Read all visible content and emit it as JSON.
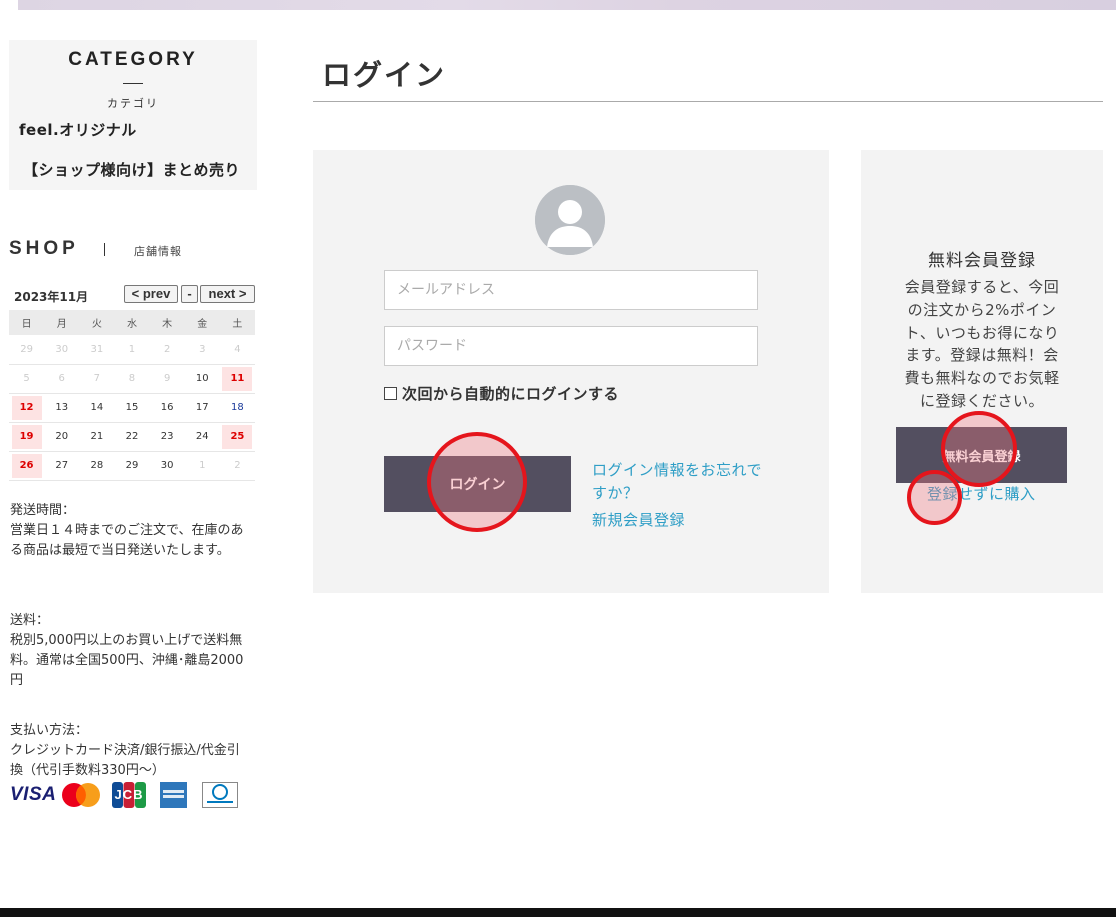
{
  "sidebar": {
    "category_title": "CATEGORY",
    "category_subtitle": "カテゴリ",
    "categories": [
      "feel.オリジナル",
      "【ショップ様向け】まとめ売り"
    ],
    "shop_title": "SHOP",
    "shop_info_link": "店舗情報"
  },
  "calendar": {
    "month_label": "2023年11月",
    "prev_label": "< prev",
    "reset_label": "-",
    "next_label": "next >",
    "weekdays": [
      "日",
      "月",
      "火",
      "水",
      "木",
      "金",
      "土"
    ],
    "weeks": [
      [
        "29",
        "30",
        "31",
        "1",
        "2",
        "3",
        "4"
      ],
      [
        "5",
        "6",
        "7",
        "8",
        "9",
        "10",
        "11"
      ],
      [
        "12",
        "13",
        "14",
        "15",
        "16",
        "17",
        "18"
      ],
      [
        "19",
        "20",
        "21",
        "22",
        "23",
        "24",
        "25"
      ],
      [
        "26",
        "27",
        "28",
        "29",
        "30",
        "1",
        "2"
      ]
    ]
  },
  "info": {
    "shipping_time_label": "発送時間：",
    "shipping_time_text": "営業日１４時までのご注文で、在庫のある商品は最短で当日発送いたします。",
    "shipping_fee_label": "送料：",
    "shipping_fee_text": "税別5,000円以上のお買い上げで送料無料。通常は全国500円、沖縄･離島2000円",
    "payment_label": "支払い方法：",
    "payment_text": "クレジットカード決済/銀行振込/代金引換（代引手数料330円〜）",
    "card_visa": "VISA",
    "card_jcb": "JCB"
  },
  "main": {
    "title": "ログイン",
    "email_placeholder": "メールアドレス",
    "password_placeholder": "パスワード",
    "remember_label": "次回から自動的にログインする",
    "login_button": "ログイン",
    "forgot_link": "ログイン情報をお忘れですか？",
    "register_link": "新規会員登録"
  },
  "register": {
    "title": "無料会員登録",
    "description": "会員登録すると、今回の注文から2%ポイント、いつもお得になります。登録は無料！会費も無料なのでお気軽に登録ください。",
    "button": "無料会員登録",
    "guest_link": "登録せずに購入"
  },
  "colors": {
    "button_bg": "#534f60",
    "link": "#2f9ec6",
    "holiday_bg": "#fde3e3",
    "holiday_text": "#dd0000",
    "marker": "#e5151c"
  }
}
